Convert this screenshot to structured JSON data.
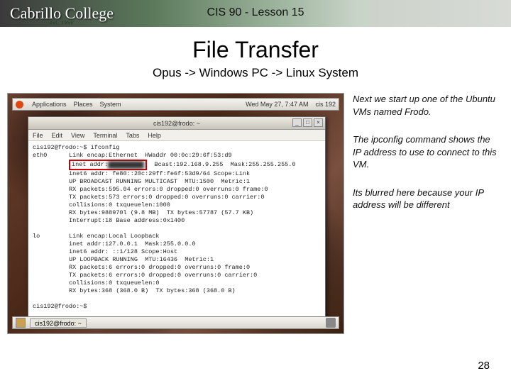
{
  "header": {
    "logo_text": "Cabrillo College",
    "est": "est. 1959",
    "course": "CIS 90 - Lesson 15"
  },
  "titles": {
    "main": "File Transfer",
    "sub": "Opus -> Windows PC -> Linux System"
  },
  "gnome_panel": {
    "menu1": "Applications",
    "menu2": "Places",
    "menu3": "System",
    "clock": "Wed May 27, 7:47 AM",
    "user": "cis 192"
  },
  "terminal": {
    "title": "cis192@frodo: ~",
    "menu_file": "File",
    "menu_edit": "Edit",
    "menu_view": "View",
    "menu_terminal": "Terminal",
    "menu_tabs": "Tabs",
    "menu_help": "Help",
    "line1": "cis192@frodo:~$ ifconfig",
    "line2": "eth0      Link encap:Ethernet  HWaddr 00:0c:29:6f:53:d9",
    "line3a": "          ",
    "line3b": "inet addr:",
    "line3c": "  Bcast:192.168.9.255  Mask:255.255.255.0",
    "line4": "          inet6 addr: fe80::20c:29ff:fe6f:53d9/64 Scope:Link",
    "line5": "          UP BROADCAST RUNNING MULTICAST  MTU:1500  Metric:1",
    "line6": "          RX packets:595.04 errors:0 dropped:0 overruns:0 frame:0",
    "line7": "          TX packets:573 errors:0 dropped:0 overruns:0 carrier:0",
    "line8": "          collisions:0 txqueuelen:1000",
    "line9": "          RX bytes:988970l (9.8 MB)  TX bytes:57787 (57.7 KB)",
    "line10": "          Interrupt:18 Base address:0x1400",
    "blank1": "",
    "line11": "lo        Link encap:Local Loopback",
    "line12": "          inet addr:127.0.0.1  Mask:255.0.0.0",
    "line13": "          inet6 addr: ::1/128 Scope:Host",
    "line14": "          UP LOOPBACK RUNNING  MTU:16436  Metric:1",
    "line15": "          RX packets:6 errors:0 dropped:0 overruns:0 frame:0",
    "line16": "          TX packets:6 errors:0 dropped:0 overruns:0 carrier:0",
    "line17": "          collisions:0 txqueuelen:0",
    "line18": "          RX bytes:368 (368.0 B)  TX bytes:368 (368.0 B)",
    "blank2": "",
    "line19": "cis192@frodo:~$"
  },
  "taskbar": {
    "button": "cis192@frodo: ~"
  },
  "notes": {
    "n1": "Next we start up one of the Ubuntu VMs named Frodo.",
    "n2a": "The ",
    "n2b": "ipconfig",
    "n2c": " command shows the IP address to use to connect to this VM.",
    "n3": "Its blurred here because your IP address will be different"
  },
  "page": "28"
}
